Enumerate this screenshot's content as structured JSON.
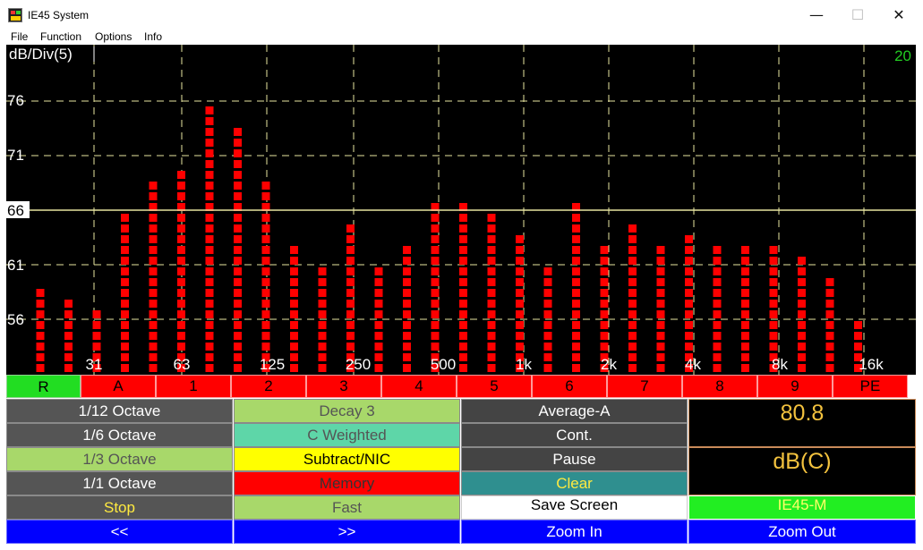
{
  "window": {
    "title": "IE45 System",
    "minimize_glyph": "—",
    "maximize_glyph": "☐",
    "close_glyph": "✕"
  },
  "menu": [
    "File",
    "Function",
    "Options",
    "Info"
  ],
  "spectrum": {
    "scale_label": "dB/Div(5)",
    "top_right_value": "20",
    "y_labels": [
      "76",
      "71",
      "66",
      "61",
      "56"
    ],
    "reference_level": "66",
    "x_labels": [
      "31",
      "63",
      "125",
      "250",
      "500",
      "1k",
      "2k",
      "4k",
      "8k",
      "16k"
    ]
  },
  "chart_data": {
    "type": "bar",
    "ylabel": "dB/Div(5)",
    "y_tick_labels": [
      76,
      71,
      66,
      61,
      56
    ],
    "reference_line": 66,
    "categories": [
      "31",
      "63",
      "125",
      "250",
      "500",
      "1k",
      "2k",
      "4k",
      "8k",
      "16k"
    ],
    "bar_segments": [
      8,
      7,
      6,
      15,
      18,
      19,
      25,
      23,
      18,
      12,
      10,
      14,
      10,
      12,
      16,
      16,
      15,
      13,
      10,
      16,
      12,
      14,
      12,
      13,
      12,
      12,
      12,
      11,
      9,
      5
    ],
    "colors": {
      "background": "#000000",
      "bar": "#ff0000",
      "grid": "#e8e6a0",
      "labels": "#ffffff",
      "top_right": "#22cc22"
    }
  },
  "bands": [
    "R",
    "A",
    "1",
    "2",
    "3",
    "4",
    "5",
    "6",
    "7",
    "8",
    "9",
    "PE"
  ],
  "controls": {
    "col1": [
      "1/12 Octave",
      "1/6 Octave",
      "1/3 Octave",
      "1/1 Octave",
      "Stop"
    ],
    "col2": [
      "Decay 3",
      "C Weighted",
      "Subtract/NIC",
      "Memory",
      "Fast"
    ],
    "col3": [
      "Average-A",
      "Cont.",
      "Pause",
      "Clear",
      "Save Screen"
    ],
    "display_value": "80.8",
    "display_unit": "dB(C)",
    "model": "IE45-M"
  },
  "nav": [
    "<<",
    ">>",
    "Zoom In",
    "Zoom Out"
  ]
}
